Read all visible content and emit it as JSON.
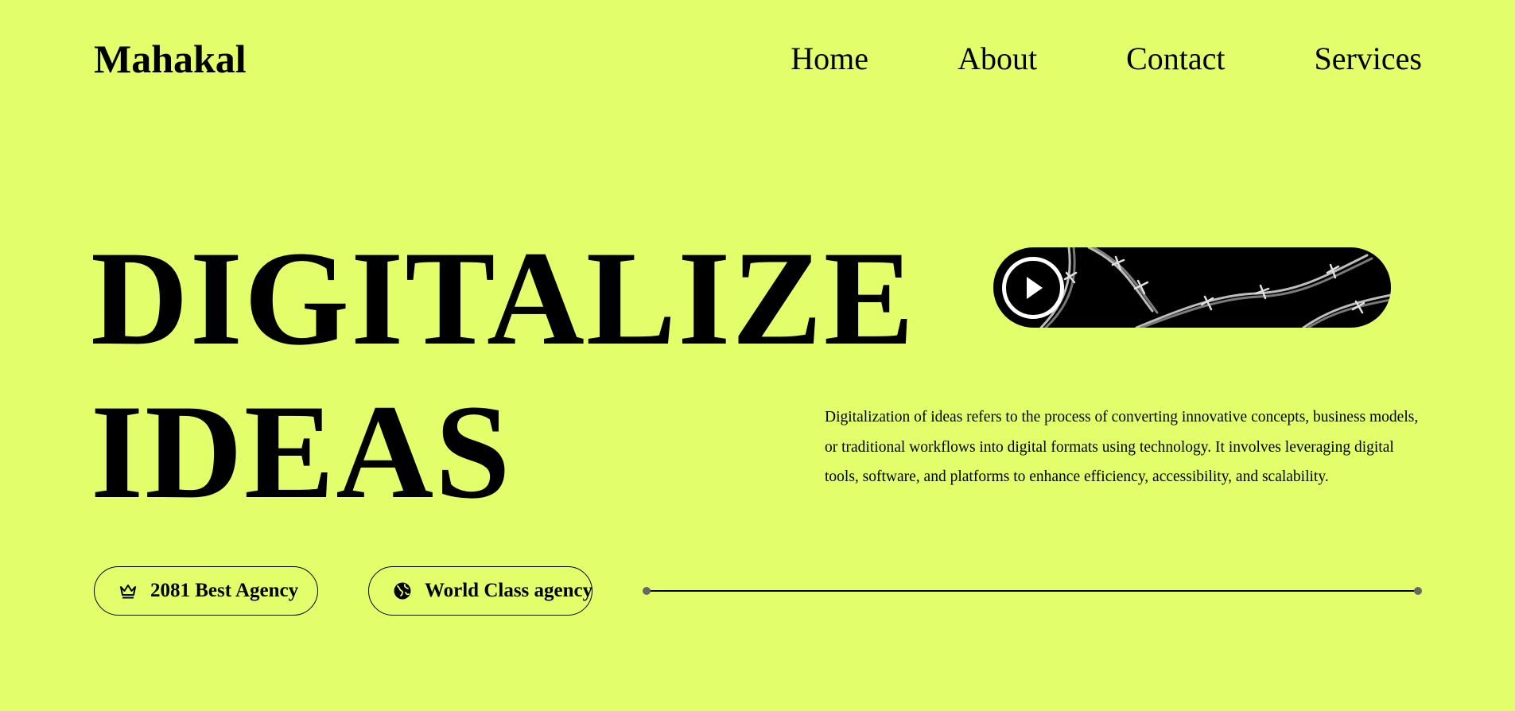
{
  "header": {
    "logo": "Mahakal",
    "nav": [
      "Home",
      "About",
      "Contact",
      "Services"
    ]
  },
  "hero": {
    "line1": "DIGITALIZE",
    "line2": "IDEAS",
    "description": "Digitalization of ideas refers to the process of converting innovative concepts, business models, or traditional workflows into digital formats using technology. It involves leveraging digital tools, software, and platforms to enhance efficiency, accessibility, and scalability."
  },
  "video": {
    "icon": "play-icon"
  },
  "badges": [
    {
      "label": "2081 Best Agency",
      "icon": "crown-icon"
    },
    {
      "label": "World Class agency",
      "icon": "globe-icon"
    }
  ],
  "colors": {
    "background": "#e2ff6b",
    "text": "#000000",
    "divider_dot": "#666666"
  }
}
